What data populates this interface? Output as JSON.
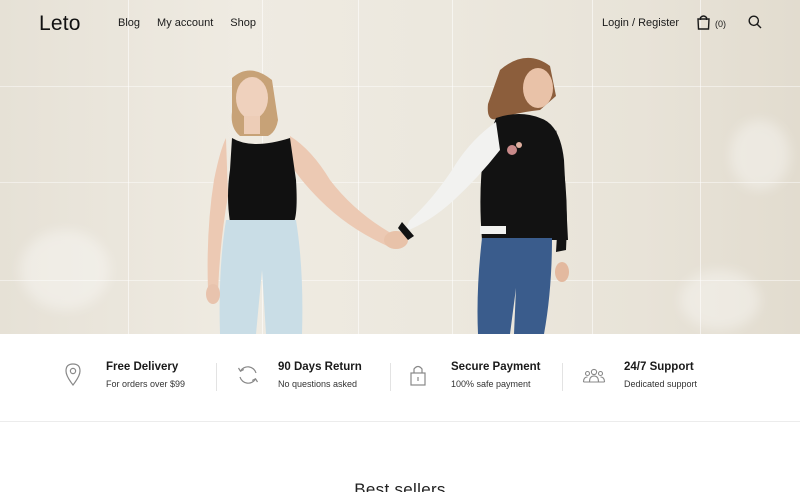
{
  "header": {
    "logo": "Leto",
    "nav": [
      {
        "label": "Blog"
      },
      {
        "label": "My account"
      },
      {
        "label": "Shop"
      }
    ],
    "login_label": "Login / Register",
    "cart_count": "(0)"
  },
  "hero": {
    "image_desc_icon": "hero-photo"
  },
  "features": [
    {
      "icon": "map-pin-icon",
      "title": "Free Delivery",
      "subtitle": "For orders over $99"
    },
    {
      "icon": "refresh-icon",
      "title": "90 Days Return",
      "subtitle": "No questions asked"
    },
    {
      "icon": "lock-icon",
      "title": "Secure Payment",
      "subtitle": "100% safe payment"
    },
    {
      "icon": "team-icon",
      "title": "24/7 Support",
      "subtitle": "Dedicated support"
    }
  ],
  "section": {
    "title": "Best sellers"
  },
  "colors": {
    "text": "#1a1a1a",
    "wall": "#ece8de",
    "divider": "#e3e3e3"
  }
}
